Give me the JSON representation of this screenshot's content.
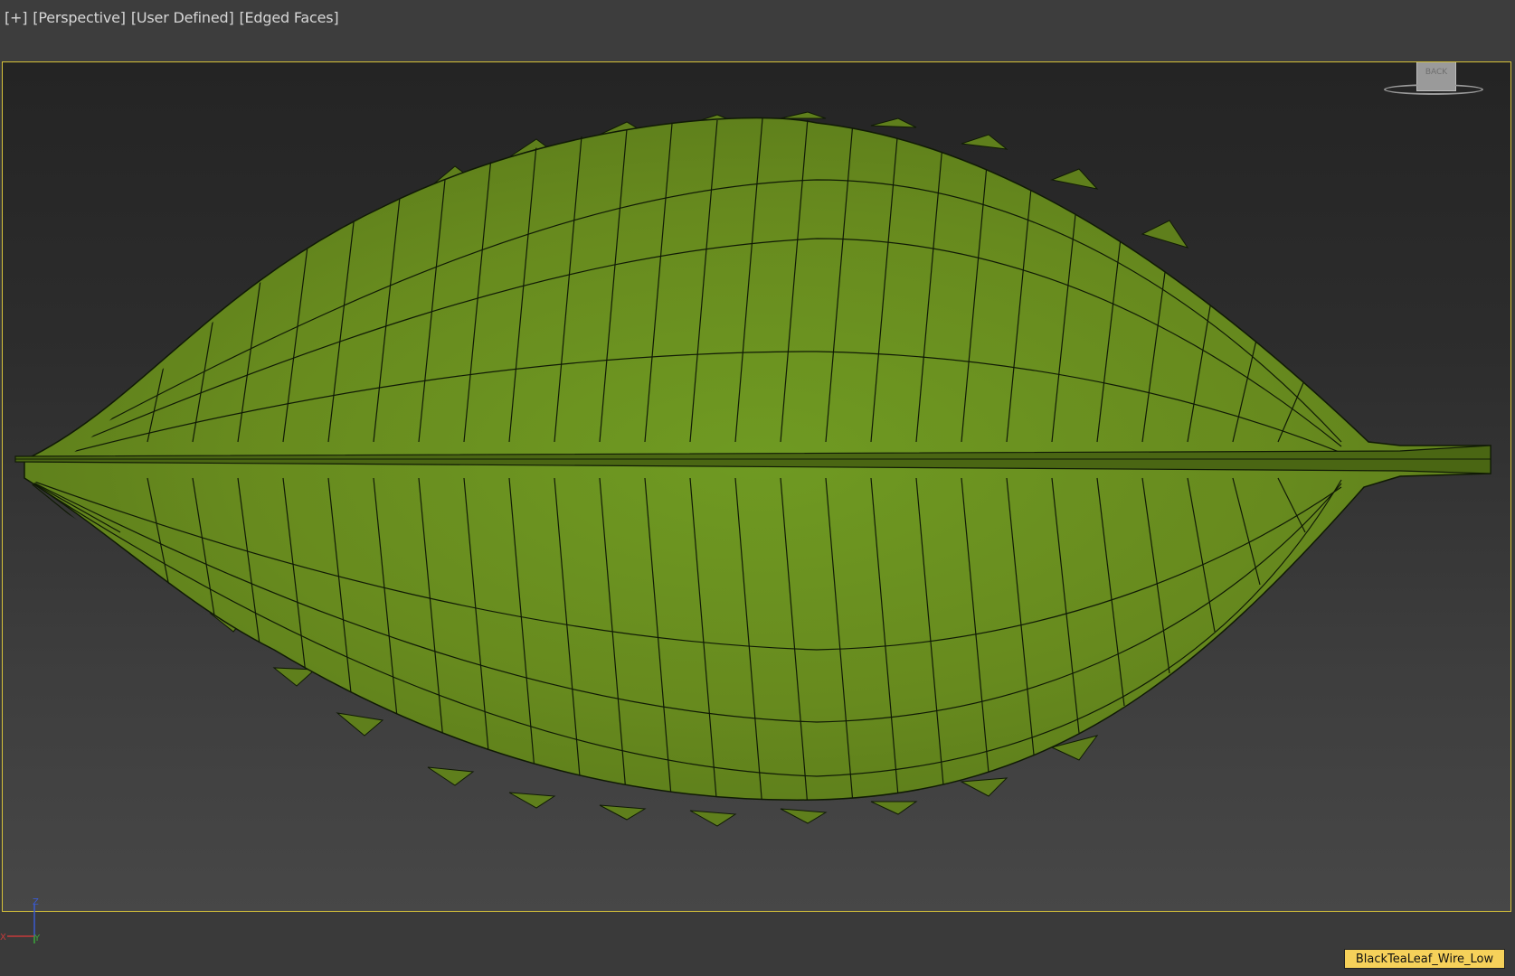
{
  "viewport": {
    "labels": [
      "[+]",
      "[Perspective]",
      "[User Defined]",
      "[Edged Faces]"
    ],
    "viewcube_face": "BACK",
    "object_name": "BlackTeaLeaf_Wire_Low",
    "axis": {
      "x": "X",
      "y": "Y",
      "z": "Z"
    }
  },
  "colors": {
    "leaf": "#6b8a1f",
    "wire": "#101a05",
    "selection_border": "#d7c23a",
    "axis_x": "#c43a3a",
    "axis_y": "#3aa83a",
    "axis_z": "#3a5ad0"
  },
  "icons": [
    "viewcube-icon",
    "axis-tripod-icon"
  ]
}
